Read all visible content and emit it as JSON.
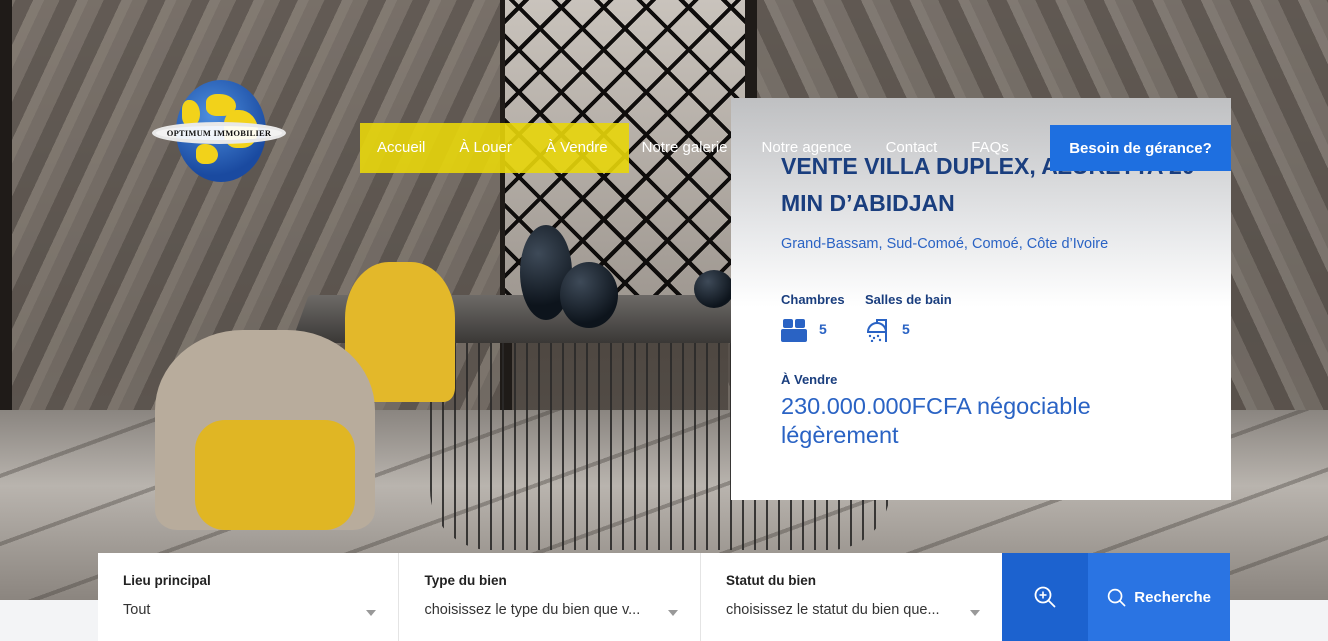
{
  "brand": {
    "logo_text": "OPTIMUM IMMOBILIER"
  },
  "nav": {
    "items": [
      {
        "label": "Accueil"
      },
      {
        "label": "À Louer"
      },
      {
        "label": "À Vendre"
      },
      {
        "label": "Notre galerie"
      },
      {
        "label": "Notre agence"
      },
      {
        "label": "Contact"
      },
      {
        "label": "FAQs"
      }
    ],
    "cta_label": "Besoin de gérance?"
  },
  "property": {
    "title": "VENTE VILLA DUPLEX, AZURETTA 20 MIN D’ABIDJAN",
    "location": "Grand-Bassam, Sud-Comoé, Comoé, Côte d’Ivoire",
    "bedrooms_label": "Chambres",
    "bedrooms_value": "5",
    "bathrooms_label": "Salles de bain",
    "bathrooms_value": "5",
    "status": "À Vendre",
    "price": "230.000.000FCFA négociable légèrement"
  },
  "search": {
    "location": {
      "label": "Lieu principal",
      "value": "Tout"
    },
    "type": {
      "label": "Type du bien",
      "value": "choisissez le type du bien que v..."
    },
    "status": {
      "label": "Statut du bien",
      "value": "choisissez le statut du bien que..."
    },
    "submit_label": "Recherche"
  },
  "colors": {
    "nav_highlight": "#e8d60a",
    "cta_blue": "#1e6fe0",
    "title_navy": "#1a3e7e",
    "link_blue": "#2a63c4"
  },
  "icons": {
    "bed": "bed-icon",
    "shower": "shower-icon",
    "advanced_search": "zoom-plus-icon",
    "search": "search-icon"
  }
}
